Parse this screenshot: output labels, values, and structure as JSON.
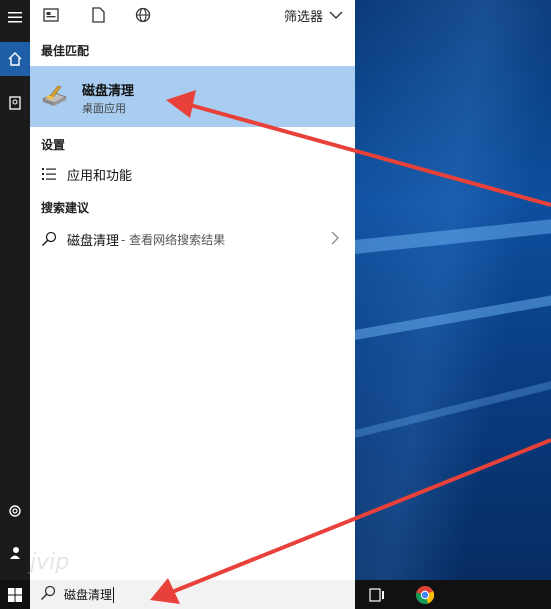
{
  "toolbar": {
    "filter_label": "筛选器"
  },
  "sections": {
    "best_match": "最佳匹配",
    "settings": "设置",
    "search_suggestions": "搜索建议"
  },
  "best_match": {
    "title": "磁盘清理",
    "subtitle": "桌面应用"
  },
  "settings_items": [
    {
      "label": "应用和功能"
    }
  ],
  "suggestions": [
    {
      "query": "磁盘清理",
      "hint": " - 查看网络搜索结果"
    }
  ],
  "search": {
    "value": "磁盘清理"
  },
  "watermark": "jvip",
  "colors": {
    "highlight": "#a8cdf0",
    "arrow": "#e8413a",
    "accent": "#1f5fa8"
  }
}
